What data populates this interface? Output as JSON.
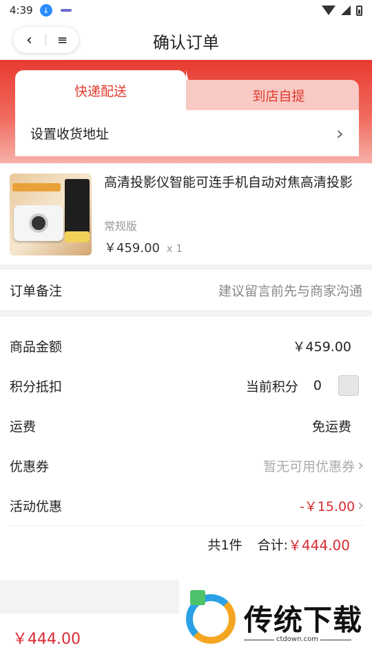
{
  "status_bar": {
    "time": "4:39"
  },
  "header": {
    "title": "确认订单",
    "back_icon": "‹",
    "menu_icon": "≡"
  },
  "delivery": {
    "tabs": [
      {
        "label": "快递配送",
        "active": true
      },
      {
        "label": "到店自提",
        "active": false
      }
    ],
    "address_label": "设置收货地址",
    "arrow": "›"
  },
  "product": {
    "title": "高清投影仪智能可连手机自动对焦高清投影",
    "variant": "常规版",
    "price": "￥459.00",
    "quantity": "x 1"
  },
  "remark": {
    "label": "订单备注",
    "placeholder": "建议留言前先与商家沟通"
  },
  "summary": {
    "goods_amount_label": "商品金额",
    "goods_amount": "￥459.00",
    "points_label": "积分抵扣",
    "current_points_label": "当前积分",
    "current_points": "0",
    "shipping_label": "运费",
    "shipping_value": "免运费",
    "coupon_label": "优惠券",
    "coupon_value": "暂无可用优惠券",
    "promo_label": "活动优惠",
    "promo_value": "-￥15.00",
    "item_count": "共1件",
    "total_label": "合计:",
    "total_amount": "￥444.00"
  },
  "bottom_bar": {
    "price": "￥444.00"
  },
  "watermark": {
    "text": "传统下载",
    "url": "ctdown.com"
  },
  "colors": {
    "accent": "#e03c2e",
    "price_red": "#d92a33",
    "tab_inactive_bg": "#f9c9c4"
  }
}
